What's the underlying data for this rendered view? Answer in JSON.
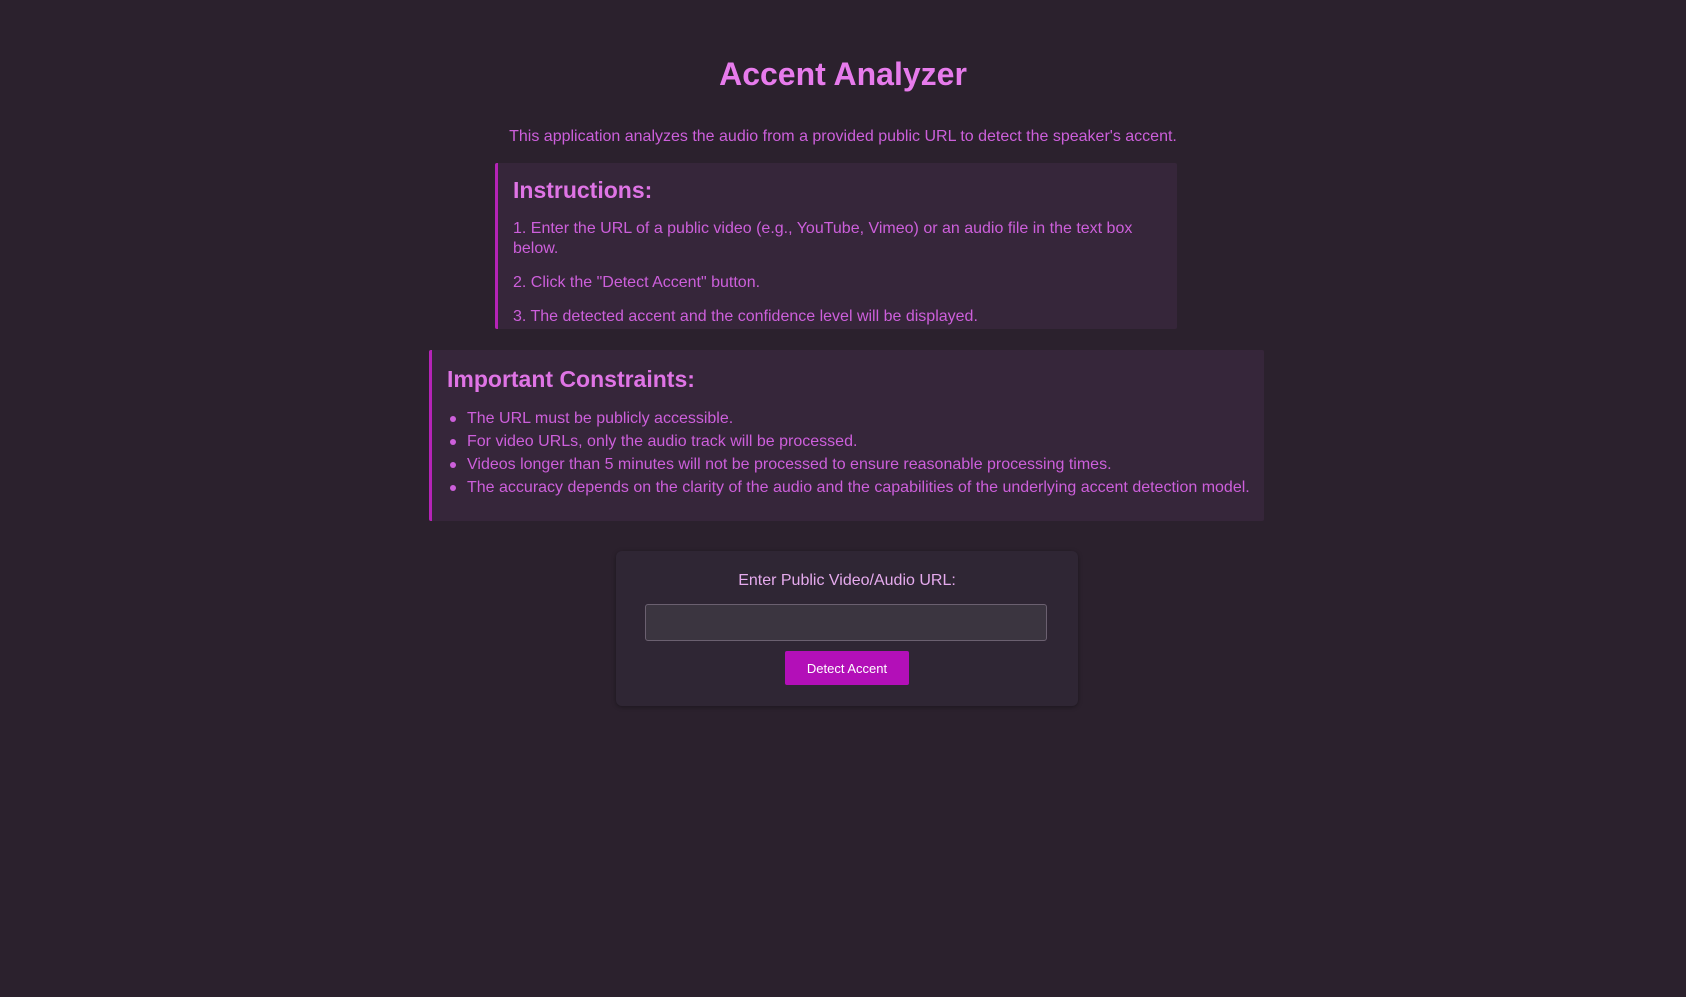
{
  "header": {
    "title": "Accent Analyzer",
    "intro": "This application analyzes the audio from a provided public URL to detect the speaker's accent."
  },
  "instructions": {
    "heading": "Instructions:",
    "steps": [
      "1. Enter the URL of a public video (e.g., YouTube, Vimeo) or an audio file in the text box below.",
      "2. Click the \"Detect Accent\" button.",
      "3. The detected accent and the confidence level will be displayed."
    ]
  },
  "constraints": {
    "heading": "Important Constraints:",
    "items": [
      "The URL must be publicly accessible.",
      "For video URLs, only the audio track will be processed.",
      "Videos longer than 5 minutes will not be processed to ensure reasonable processing times.",
      "The accuracy depends on the clarity of the audio and the capabilities of the underlying accent detection model."
    ]
  },
  "form": {
    "label": "Enter Public Video/Audio URL:",
    "url_value": "",
    "url_placeholder": "",
    "button_label": "Detect Accent"
  },
  "colors": {
    "background": "#2b212d",
    "panel": "#36263a",
    "accent": "#b523b7",
    "title": "#e77bec",
    "text": "#cd5fdb",
    "button": "#b30fb8"
  }
}
